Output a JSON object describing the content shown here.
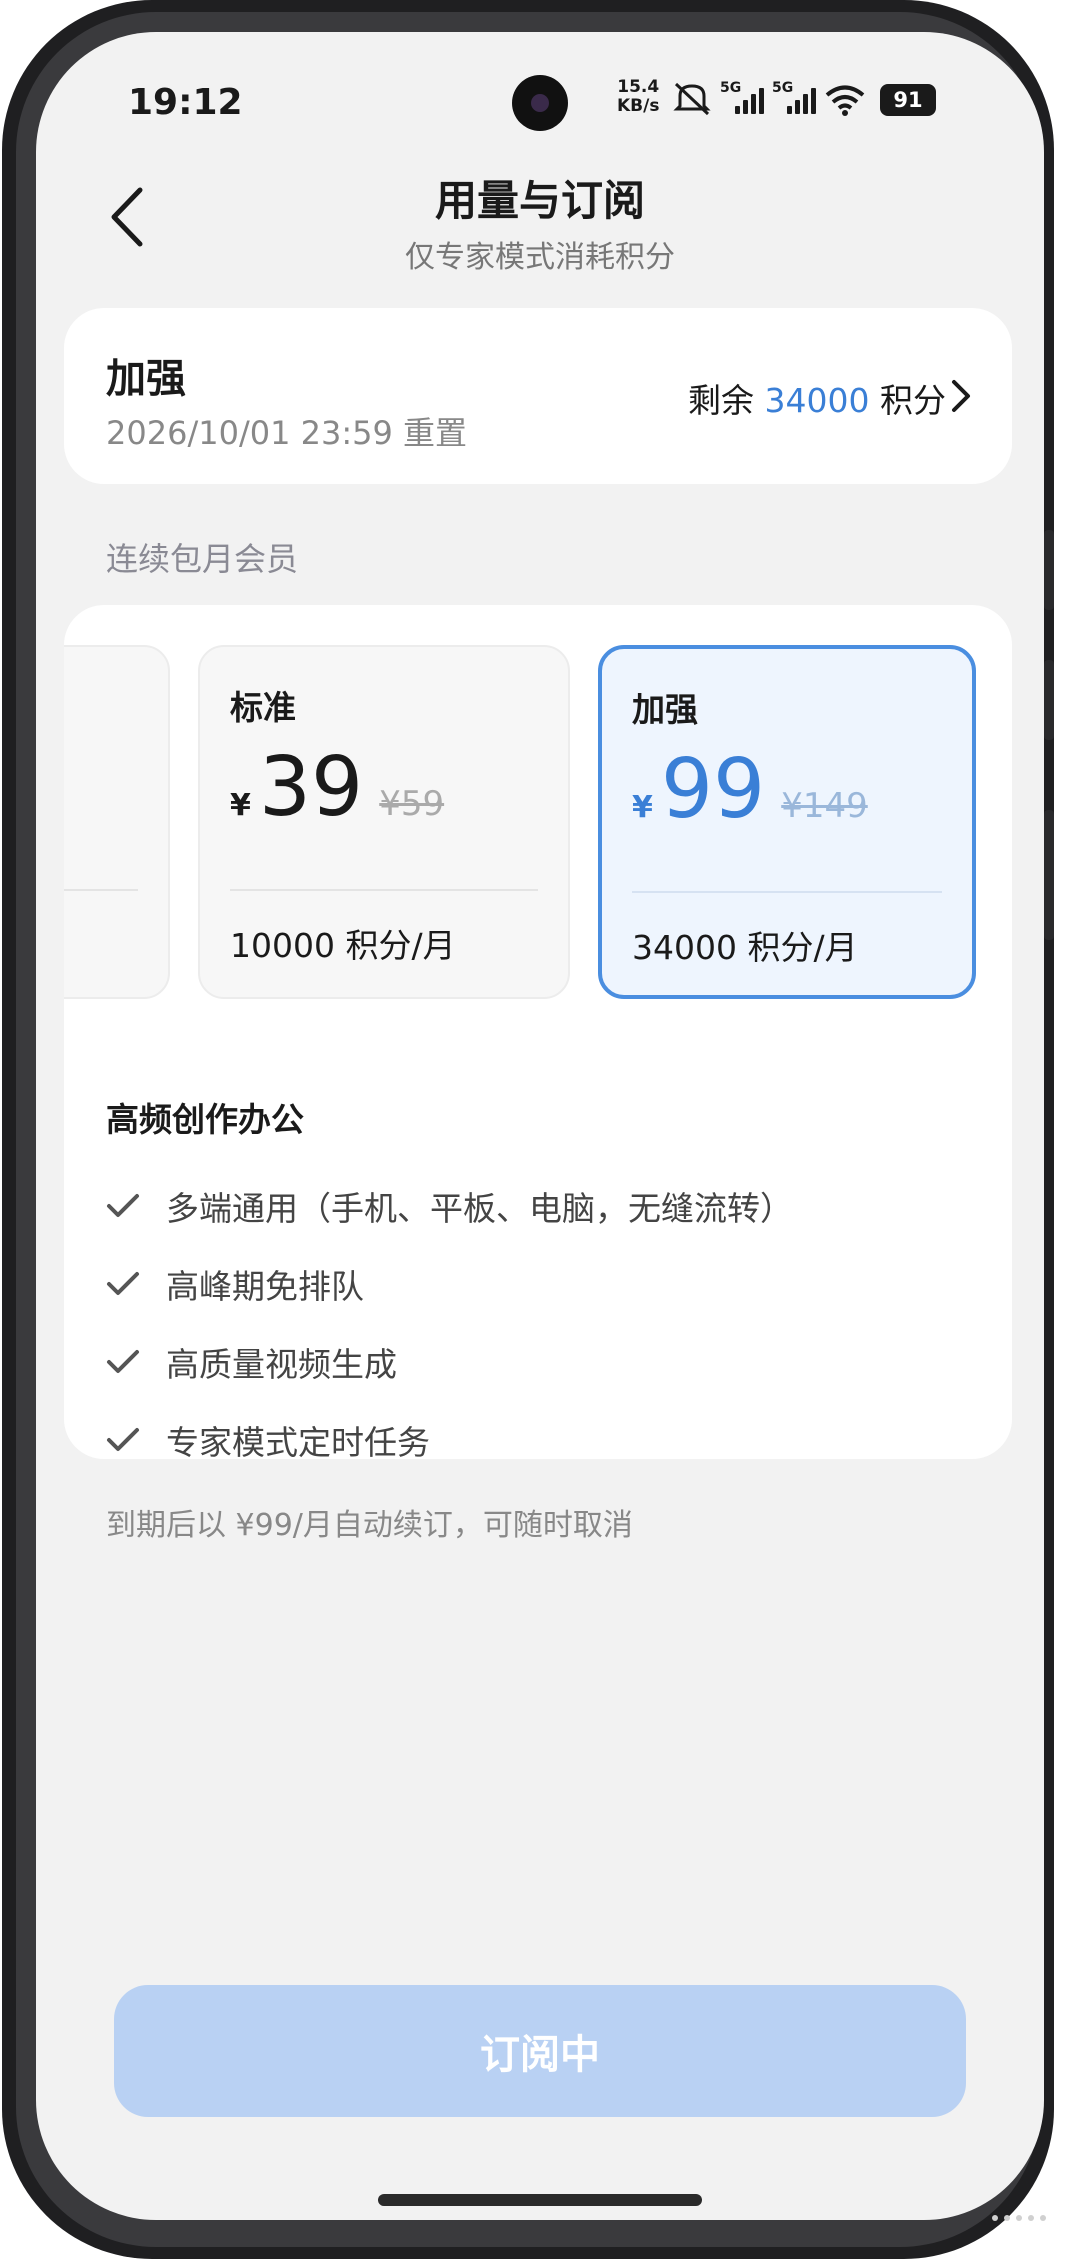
{
  "status_bar": {
    "time": "19:12",
    "net_speed_value": "15.4",
    "net_speed_unit": "KB/s",
    "sim1_label": "5G",
    "sim2_label": "5G",
    "battery": "91"
  },
  "header": {
    "title": "用量与订阅",
    "subtitle": "仅专家模式消耗积分"
  },
  "current_plan": {
    "name": "加强",
    "reset_text": "2026/10/01 23:59 重置",
    "remaining_prefix": "剩余",
    "remaining_value": "34000",
    "remaining_unit": "积分"
  },
  "section_label": "连续包月会员",
  "plans": [
    {
      "name": "标准",
      "currency": "¥",
      "price": "39",
      "original_price": "¥59",
      "credits": "10000 积分/月",
      "selected": false
    },
    {
      "name": "加强",
      "currency": "¥",
      "price": "99",
      "original_price": "¥149",
      "credits": "34000 积分/月",
      "selected": true
    }
  ],
  "features": {
    "title": "高频创作办公",
    "items": [
      "多端通用（手机、平板、电脑，无缝流转）",
      "高峰期免排队",
      "高质量视频生成",
      "专家模式定时任务"
    ]
  },
  "renew_note": "到期后以 ¥99/月自动续订，可随时取消",
  "subscribe_button": "订阅中",
  "colors": {
    "accent": "#3a7fd6",
    "button_disabled": "#b9d1f3",
    "background": "#f2f2f2"
  }
}
